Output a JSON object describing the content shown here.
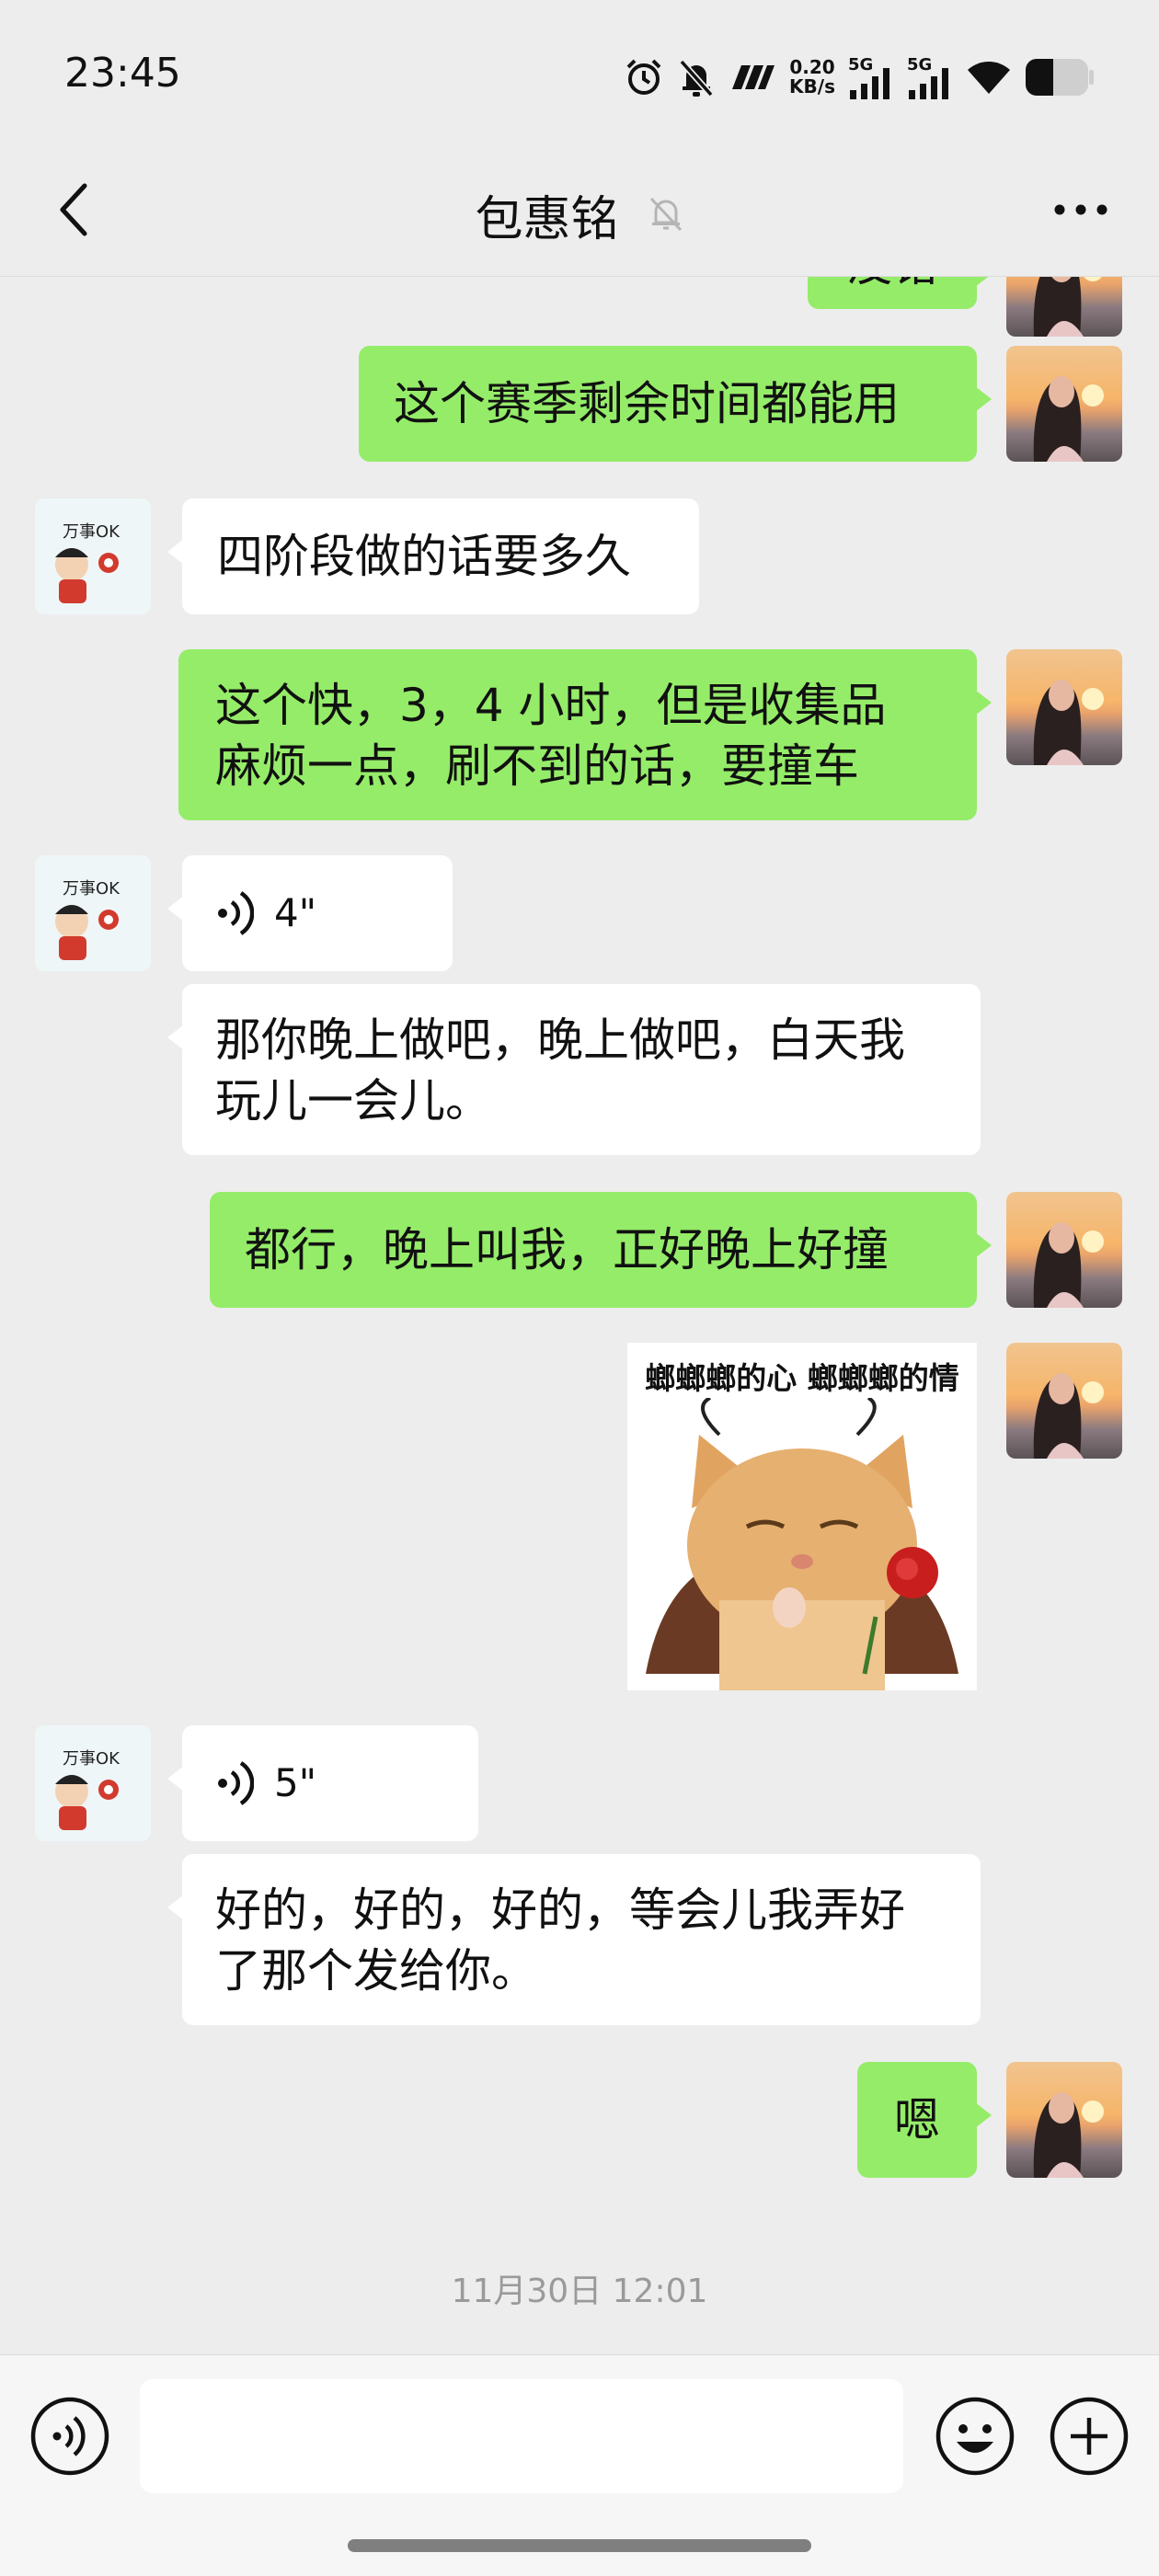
{
  "status_bar": {
    "time": "23:45",
    "net_speed_value": "0.20",
    "net_speed_unit": "KB/s",
    "sim1": "5G",
    "sim2": "5G",
    "icons": [
      "alarm-icon",
      "mute-bell-icon",
      "nfc-icon",
      "signal-icon",
      "signal-icon",
      "wifi-icon",
      "battery-icon"
    ]
  },
  "header": {
    "title": "包惠铭",
    "back_icon": "chevron-left-icon",
    "mute_icon": "bell-off-icon",
    "more_icon": "more-dots-icon"
  },
  "messages": [
    {
      "sender": "me",
      "type": "text",
      "text": "没错"
    },
    {
      "sender": "me",
      "type": "text",
      "text": "这个赛季剩余时间都能用"
    },
    {
      "sender": "them",
      "type": "text",
      "text": "四阶段做的话要多久"
    },
    {
      "sender": "me",
      "type": "text",
      "lines": [
        "这个快，3，4 小时，但是收集品",
        "麻烦一点，刷不到的话，要撞车"
      ]
    },
    {
      "sender": "them",
      "type": "voice",
      "duration": "4\""
    },
    {
      "sender": "them",
      "type": "text",
      "lines": [
        "那你晚上做吧，晚上做吧，白天我",
        "玩儿一会儿。"
      ]
    },
    {
      "sender": "me",
      "type": "text",
      "text": "都行，晚上叫我，正好晚上好撞"
    },
    {
      "sender": "me",
      "type": "sticker",
      "caption": "螂螂螂的心 螂螂螂的情"
    },
    {
      "sender": "them",
      "type": "voice",
      "duration": "5\""
    },
    {
      "sender": "them",
      "type": "text",
      "lines": [
        "好的，好的，好的，等会儿我弄好",
        "了那个发给你。"
      ]
    },
    {
      "sender": "me",
      "type": "text",
      "text": "嗯"
    }
  ],
  "contact_avatar": {
    "text": "万事OK"
  },
  "timestamp": "11月30日 12:01",
  "input_bar": {
    "placeholder": "",
    "voice_icon": "voice-mode-icon",
    "emoji_icon": "emoji-icon",
    "plus_icon": "plus-icon"
  },
  "colors": {
    "background": "#ededed",
    "my_bubble": "#95ec69",
    "their_bubble": "#ffffff",
    "timestamp": "#9a9a9a"
  }
}
